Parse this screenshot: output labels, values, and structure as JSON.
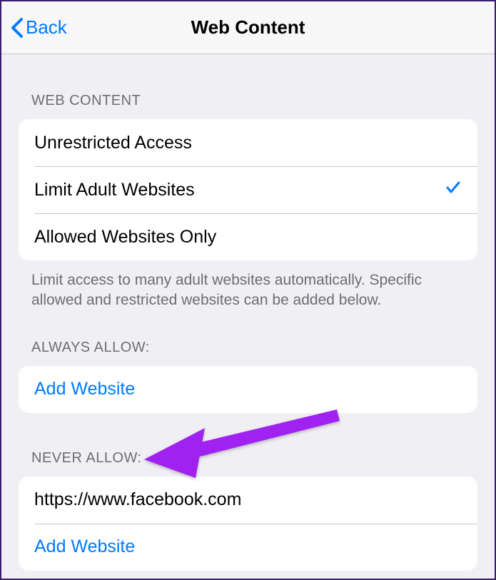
{
  "nav": {
    "back_label": "Back",
    "title": "Web Content"
  },
  "sections": {
    "web_content": {
      "header": "WEB CONTENT",
      "options": [
        {
          "label": "Unrestricted Access",
          "selected": false
        },
        {
          "label": "Limit Adult Websites",
          "selected": true
        },
        {
          "label": "Allowed Websites Only",
          "selected": false
        }
      ],
      "footer": "Limit access to many adult websites automatically. Specific allowed and restricted websites can be added below."
    },
    "always_allow": {
      "header": "ALWAYS ALLOW:",
      "add_label": "Add Website"
    },
    "never_allow": {
      "header": "NEVER ALLOW:",
      "items": [
        "https://www.facebook.com"
      ],
      "add_label": "Add Website"
    }
  },
  "annotation": {
    "arrow_color": "#a020f0"
  }
}
